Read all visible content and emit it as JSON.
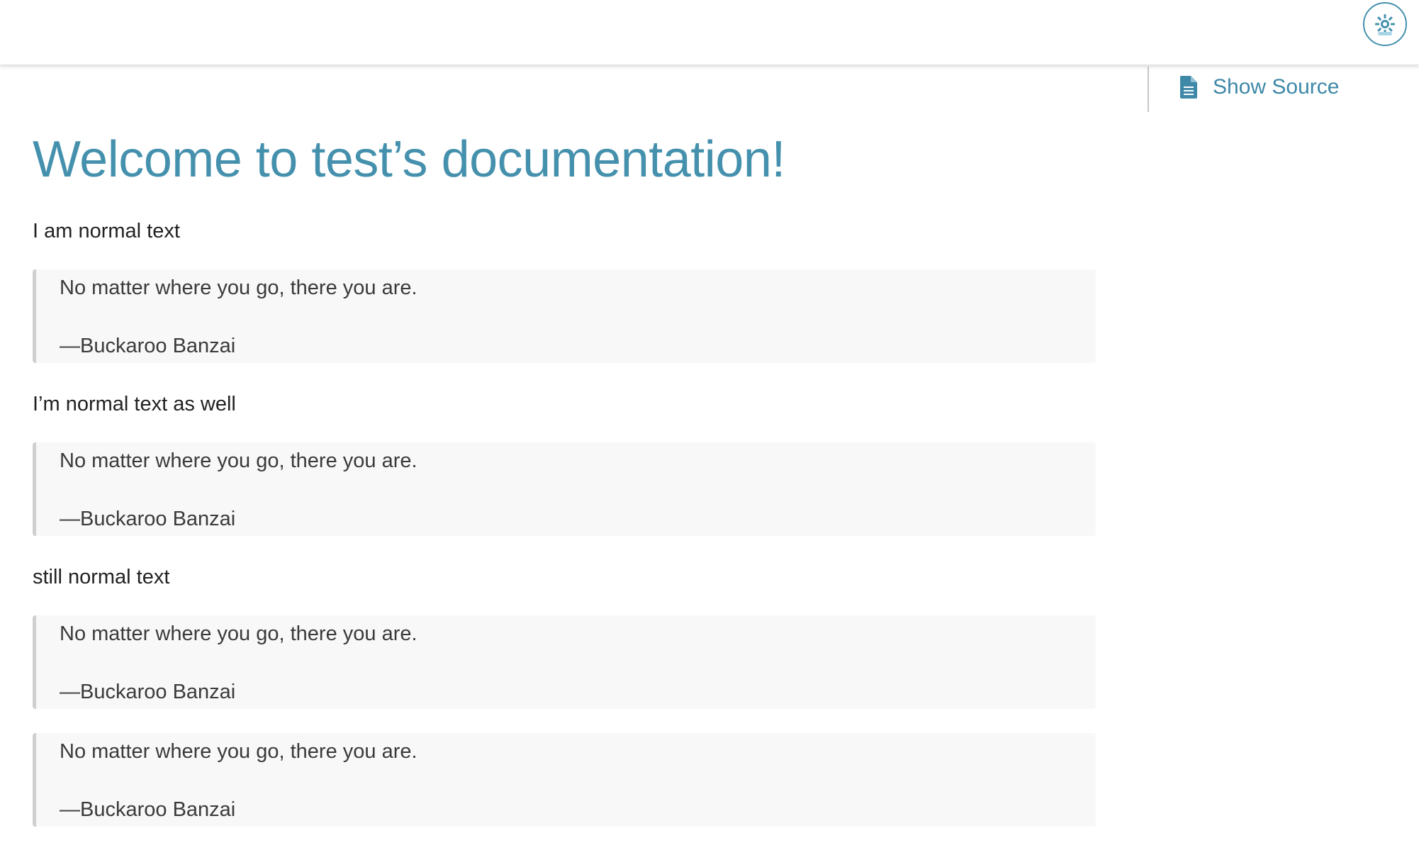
{
  "header": {
    "theme_toggle_icon": "sun-icon"
  },
  "aside": {
    "show_source_label": "Show Source",
    "show_source_icon": "document-icon"
  },
  "main": {
    "title": "Welcome to test’s documentation!",
    "paragraphs": [
      "I am normal text",
      "I’m normal text as well",
      "still normal text"
    ],
    "quotes": [
      {
        "text": "No matter where you go, there you are.",
        "attribution": "—Buckaroo Banzai"
      },
      {
        "text": "No matter where you go, there you are.",
        "attribution": "—Buckaroo Banzai"
      },
      {
        "text": "No matter where you go, there you are.",
        "attribution": "—Buckaroo Banzai"
      },
      {
        "text": "No matter where you go, there you are.",
        "attribution": "—Buckaroo Banzai"
      }
    ]
  },
  "colors": {
    "accent": "#4591ad",
    "quote_background": "#f8f8f8",
    "quote_border": "#cfcfcf",
    "text": "#222222"
  }
}
